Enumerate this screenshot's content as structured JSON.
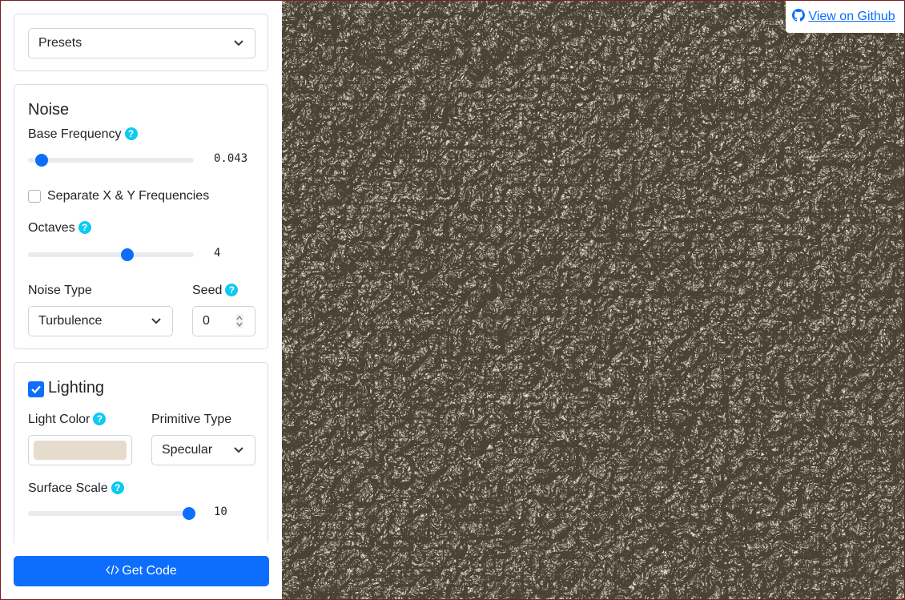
{
  "presets": {
    "label": "Presets"
  },
  "noise": {
    "heading": "Noise",
    "base_frequency": {
      "label": "Base Frequency",
      "value": "0.043",
      "fraction": 0.08
    },
    "separate_xy": {
      "label": "Separate X & Y Frequencies",
      "checked": false
    },
    "octaves": {
      "label": "Octaves",
      "value": "4",
      "fraction": 0.6
    },
    "noise_type": {
      "label": "Noise Type",
      "selected": "Turbulence"
    },
    "seed": {
      "label": "Seed",
      "value": "0"
    }
  },
  "lighting": {
    "heading": "Lighting",
    "enabled": true,
    "light_color": {
      "label": "Light Color",
      "color": "#e6dccd"
    },
    "primitive_type": {
      "label": "Primitive Type",
      "selected": "Specular"
    },
    "surface_scale": {
      "label": "Surface Scale",
      "value": "10",
      "fraction": 0.97
    }
  },
  "get_code": {
    "label": "Get Code"
  },
  "github": {
    "label": "View on Github"
  },
  "colors": {
    "accent": "#0d6efd",
    "help": "#0dcaf0",
    "texture_dark": "#4a4235",
    "texture_light": "#e6dccd"
  },
  "help_icon": "?"
}
